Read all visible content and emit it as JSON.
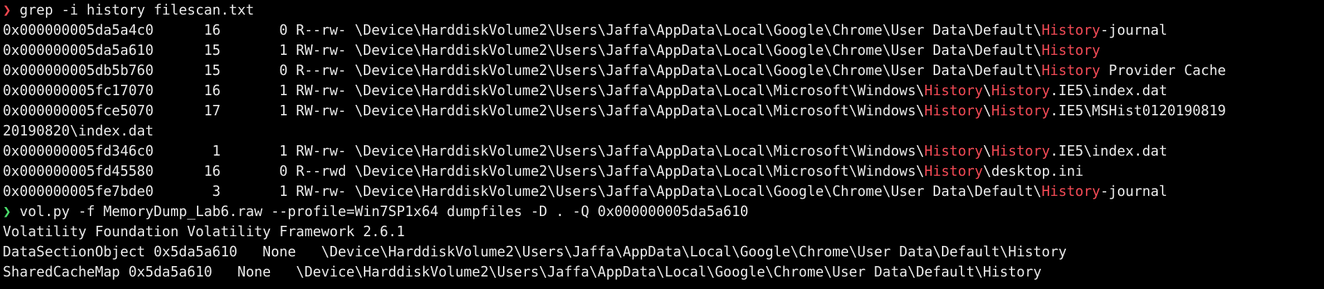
{
  "terminal": {
    "prompt_glyph": "❯",
    "commands": [
      {
        "text": "grep -i history filescan.txt",
        "status": "error"
      },
      {
        "text": "vol.py -f MemoryDump_Lab6.raw --profile=Win7SP1x64 dumpfiles -D . -Q 0x000000005da5a610",
        "status": "ok"
      }
    ],
    "grep_rows": [
      {
        "offset": "0x000000005da5a4c0",
        "ptr": "16",
        "hnd": "0",
        "access": "R--rw-",
        "path": [
          "\\Device\\HarddiskVolume2\\Users\\Jaffa\\AppData\\Local\\Google\\Chrome\\User Data\\Default\\",
          "History",
          "-journal"
        ]
      },
      {
        "offset": "0x000000005da5a610",
        "ptr": "15",
        "hnd": "1",
        "access": "RW-rw-",
        "path": [
          "\\Device\\HarddiskVolume2\\Users\\Jaffa\\AppData\\Local\\Google\\Chrome\\User Data\\Default\\",
          "History",
          ""
        ]
      },
      {
        "offset": "0x000000005db5b760",
        "ptr": "15",
        "hnd": "0",
        "access": "R--rw-",
        "path": [
          "\\Device\\HarddiskVolume2\\Users\\Jaffa\\AppData\\Local\\Google\\Chrome\\User Data\\Default\\",
          "History",
          " Provider Cache"
        ]
      },
      {
        "offset": "0x000000005fc17070",
        "ptr": "16",
        "hnd": "1",
        "access": "RW-rw-",
        "path": [
          "\\Device\\HarddiskVolume2\\Users\\Jaffa\\AppData\\Local\\Microsoft\\Windows\\",
          "History",
          "\\",
          "History",
          ".IE5\\index.dat"
        ]
      },
      {
        "offset": "0x000000005fce5070",
        "ptr": "17",
        "hnd": "1",
        "access": "RW-rw-",
        "path": [
          "\\Device\\HarddiskVolume2\\Users\\Jaffa\\AppData\\Local\\Microsoft\\Windows\\",
          "History",
          "\\",
          "History",
          ".IE5\\MSHist0120190819"
        ],
        "wrap": "20190820\\index.dat"
      },
      {
        "offset": "0x000000005fd346c0",
        "ptr": "1",
        "hnd": "1",
        "access": "RW-rw-",
        "path": [
          "\\Device\\HarddiskVolume2\\Users\\Jaffa\\AppData\\Local\\Microsoft\\Windows\\",
          "History",
          "\\",
          "History",
          ".IE5\\index.dat"
        ]
      },
      {
        "offset": "0x000000005fd45580",
        "ptr": "16",
        "hnd": "0",
        "access": "R--rwd",
        "path": [
          "\\Device\\HarddiskVolume2\\Users\\Jaffa\\AppData\\Local\\Microsoft\\Windows\\",
          "History",
          "\\desktop.ini"
        ]
      },
      {
        "offset": "0x000000005fe7bde0",
        "ptr": "3",
        "hnd": "1",
        "access": "RW-rw-",
        "path": [
          "\\Device\\HarddiskVolume2\\Users\\Jaffa\\AppData\\Local\\Google\\Chrome\\User Data\\Default\\",
          "History",
          "-journal"
        ]
      }
    ],
    "vol_output": [
      "Volatility Foundation Volatility Framework 2.6.1",
      "DataSectionObject 0x5da5a610   None   \\Device\\HarddiskVolume2\\Users\\Jaffa\\AppData\\Local\\Google\\Chrome\\User Data\\Default\\History",
      "SharedCacheMap 0x5da5a610   None   \\Device\\HarddiskVolume2\\Users\\Jaffa\\AppData\\Local\\Google\\Chrome\\User Data\\Default\\History"
    ],
    "colors": {
      "background": "#000000",
      "foreground": "#e8e8e8",
      "highlight": "#f24a55",
      "prompt_error": "#f0474f",
      "prompt_ok": "#4bdc6b"
    }
  }
}
